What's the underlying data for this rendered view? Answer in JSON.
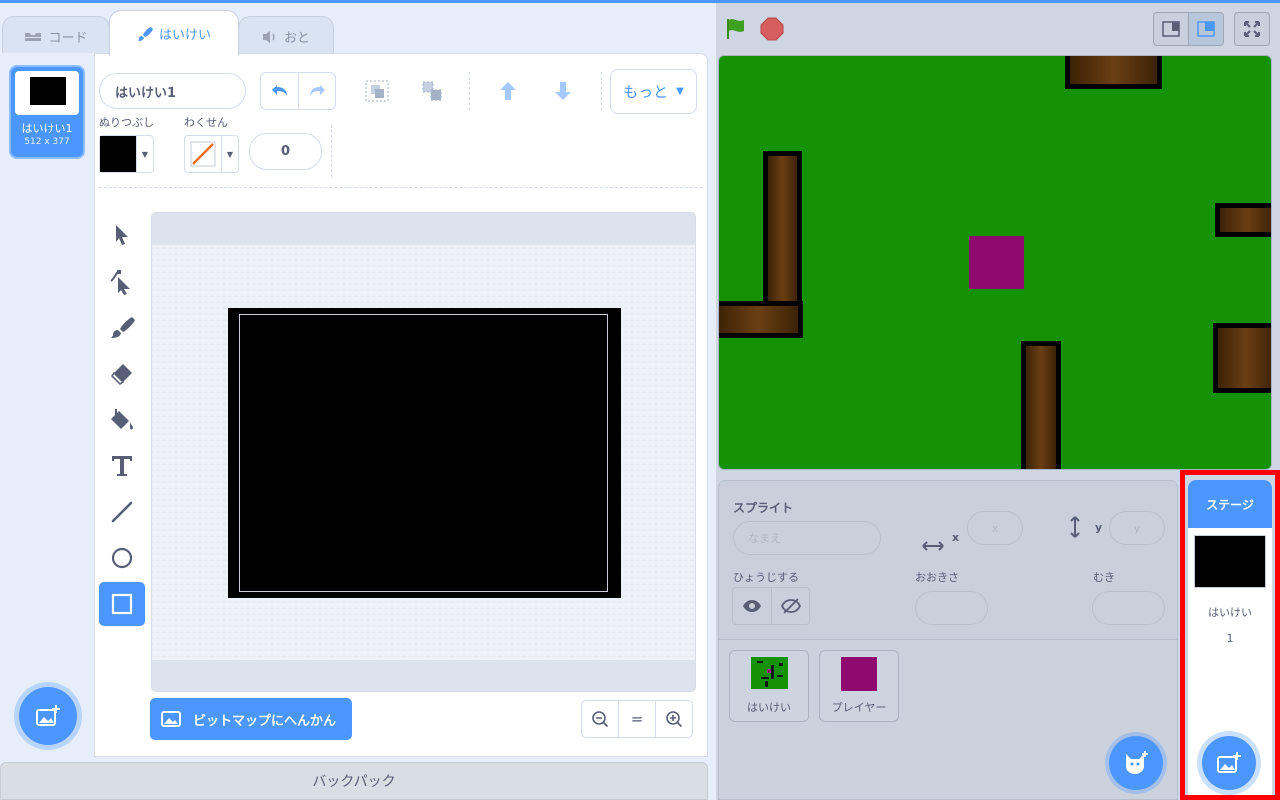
{
  "tabs": [
    {
      "label": "コード",
      "icon": "code-blocks-icon"
    },
    {
      "label": "はいけい",
      "icon": "paintbrush-icon",
      "active": true
    },
    {
      "label": "おと",
      "icon": "speaker-icon"
    }
  ],
  "costume_list": {
    "items": [
      {
        "number": "1",
        "name": "はいけい1",
        "size": "512 x 377",
        "selected": true
      }
    ]
  },
  "toolbar": {
    "costume_name": "はいけい1",
    "more_label": "もっと",
    "fill_label": "ぬりつぶし",
    "outline_label": "わくせん",
    "fill_color": "#000000",
    "outline_value": "0"
  },
  "tools": [
    {
      "name": "select-tool",
      "icon": "arrow-cursor-icon"
    },
    {
      "name": "reshape-tool",
      "icon": "reshape-cursor-icon"
    },
    {
      "name": "brush-tool",
      "icon": "brush-icon"
    },
    {
      "name": "eraser-tool",
      "icon": "eraser-icon"
    },
    {
      "name": "fill-tool",
      "icon": "paint-bucket-icon"
    },
    {
      "name": "text-tool",
      "icon": "text-t-icon"
    },
    {
      "name": "line-tool",
      "icon": "line-icon"
    },
    {
      "name": "circle-tool",
      "icon": "circle-icon"
    },
    {
      "name": "rectangle-tool",
      "icon": "square-icon",
      "active": true
    }
  ],
  "canvas": {
    "bitmap_button_label": "ビットマップにへんかん",
    "zoom_equal_label": "="
  },
  "backpack": {
    "label": "バックパック"
  },
  "sprite_info": {
    "sprite_label": "スプライト",
    "name_placeholder": "なまえ",
    "x_label": "x",
    "x_placeholder": "x",
    "y_label": "y",
    "y_placeholder": "y",
    "show_label": "ひょうじする",
    "size_label": "おおきさ",
    "direction_label": "むき"
  },
  "sprites": [
    {
      "name": "はいけい",
      "thumb_color": "#159203"
    },
    {
      "name": "プレイヤー",
      "thumb_color": "#8e0a6e"
    }
  ],
  "stage_pane": {
    "title": "ステージ",
    "backdrop_label": "はいけい",
    "backdrop_count": "1"
  },
  "colors": {
    "accent": "#4c97ff",
    "stage_green": "#159203",
    "player": "#8e0a6e",
    "highlight": "#ff0000"
  }
}
